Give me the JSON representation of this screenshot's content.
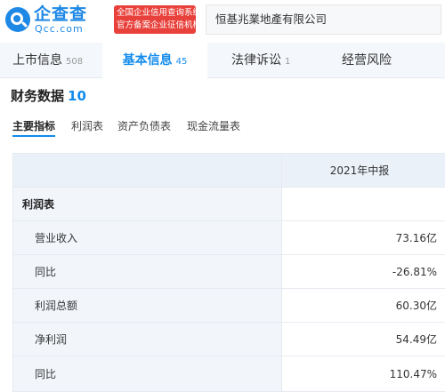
{
  "header": {
    "logo_name": "企查查",
    "logo_domain": "Qcc.com",
    "badge_line1": "全国企业信用查询系统",
    "badge_line2": "官方备案企业征信机构",
    "company_name": "恒基兆業地產有限公司"
  },
  "tabs": [
    {
      "label": "上市信息",
      "count": "508"
    },
    {
      "label": "基本信息",
      "count": "45"
    },
    {
      "label": "法律诉讼",
      "count": "1"
    },
    {
      "label": "经营风险",
      "count": ""
    }
  ],
  "section": {
    "title": "财务数据",
    "count": "10"
  },
  "subtabs": [
    "主要指标",
    "利润表",
    "资产负债表",
    "现金流量表"
  ],
  "table": {
    "period": "2021年中报",
    "group_label": "利润表",
    "rows": [
      {
        "label": "营业收入",
        "value": "73.16亿"
      },
      {
        "label": "同比",
        "value": "-26.81%"
      },
      {
        "label": "利润总额",
        "value": "60.30亿"
      },
      {
        "label": "净利润",
        "value": "54.49亿"
      },
      {
        "label": "同比",
        "value": "110.47%"
      }
    ]
  },
  "colors": {
    "brand": "#1e88e5",
    "accent": "#128bed",
    "badge": "#e8413b"
  },
  "icons": {
    "logo": "magnifier-logo-icon"
  }
}
